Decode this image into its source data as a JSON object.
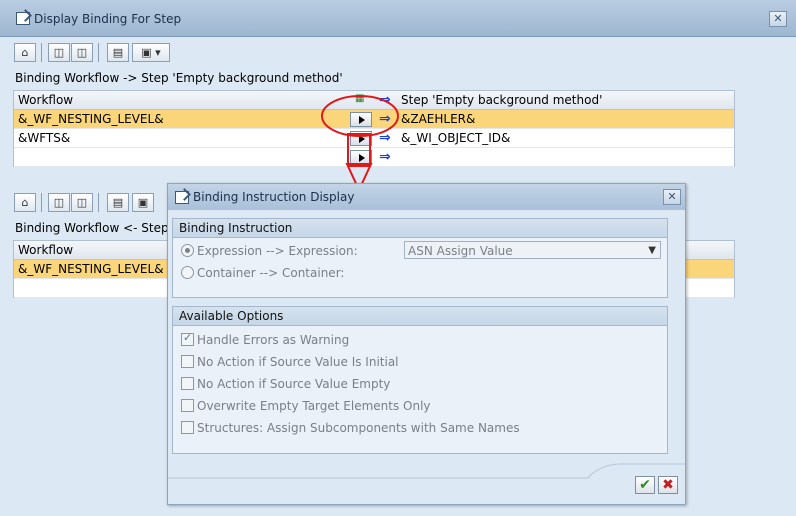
{
  "window": {
    "title": "Display Binding For Step",
    "close_glyph": "✕"
  },
  "toolbar_icons": [
    "binding-icon",
    "binoculars-icon",
    "binoculars-next-icon",
    "print-icon",
    "export-icon"
  ],
  "section_top": {
    "caption": "Binding Workflow  -> Step 'Empty background method'",
    "left_header": "Workflow",
    "right_header": "Step 'Empty background method'",
    "rows": [
      {
        "left": "&_WF_NESTING_LEVEL&",
        "right": "&ZAEHLER&"
      },
      {
        "left": "&WFTS&",
        "right": "&_WI_OBJECT_ID&"
      },
      {
        "left": "",
        "right": ""
      }
    ]
  },
  "section_bottom": {
    "caption": "Binding Workflow  <- Step '",
    "left_header": "Workflow",
    "rows": [
      {
        "left": "&_WF_NESTING_LEVEL&"
      },
      {
        "left": ""
      }
    ]
  },
  "dialog": {
    "title": "Binding Instruction Display",
    "close_glyph": "✕",
    "binding_instruction": {
      "heading": "Binding Instruction",
      "option_expression": "Expression --> Expression:",
      "option_container": "Container --> Container:",
      "assign_value": "ASN Assign Value"
    },
    "available_options": {
      "heading": "Available Options",
      "items": [
        {
          "label": "Handle Errors as Warning",
          "checked": true
        },
        {
          "label": "No Action if Source Value Is Initial",
          "checked": false
        },
        {
          "label": "No Action if Source Value Empty",
          "checked": false
        },
        {
          "label": "Overwrite Empty Target Elements Only",
          "checked": false
        },
        {
          "label": "Structures: Assign Subcomponents with Same Names",
          "checked": false
        }
      ]
    },
    "ok_glyph": "✔",
    "cancel_glyph": "✖"
  },
  "colors": {
    "selected_row": "#fbd57a",
    "annotation_red": "#e01818"
  }
}
